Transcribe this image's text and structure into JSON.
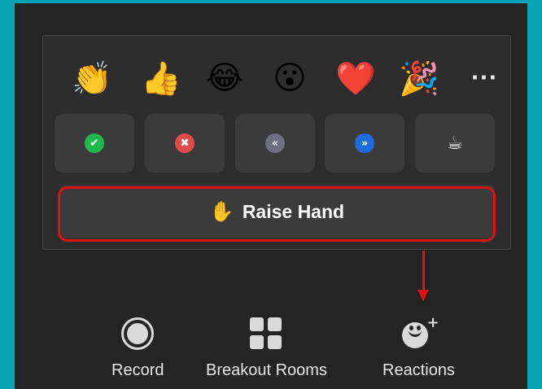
{
  "reactions_popup": {
    "emojis": [
      {
        "name": "clapping-hands",
        "glyph": "👏"
      },
      {
        "name": "thumbs-up",
        "glyph": "👍"
      },
      {
        "name": "tears-of-joy",
        "glyph": "😂"
      },
      {
        "name": "open-mouth",
        "glyph": "😮"
      },
      {
        "name": "red-heart",
        "glyph": "❤️"
      },
      {
        "name": "party-popper",
        "glyph": "🎉"
      }
    ],
    "more_label": "···",
    "status_buttons": [
      {
        "name": "yes",
        "glyph": "✔",
        "color": "#1db94a"
      },
      {
        "name": "no",
        "glyph": "✖",
        "color": "#e24a4a"
      },
      {
        "name": "slow-down",
        "glyph": "«",
        "color": "#6f6f7f"
      },
      {
        "name": "speed-up",
        "glyph": "»",
        "color": "#1d6de0"
      },
      {
        "name": "coffee",
        "glyph": "☕"
      }
    ],
    "raise_hand": {
      "icon": "✋",
      "label": "Raise Hand"
    }
  },
  "toolbar": {
    "record_label": "Record",
    "breakout_label": "Breakout Rooms",
    "reactions_label": "Reactions",
    "reactions_plus": "+"
  },
  "colors": {
    "background": "#0aa3b4",
    "panel": "#2d2d2d",
    "highlight": "#e01010"
  }
}
